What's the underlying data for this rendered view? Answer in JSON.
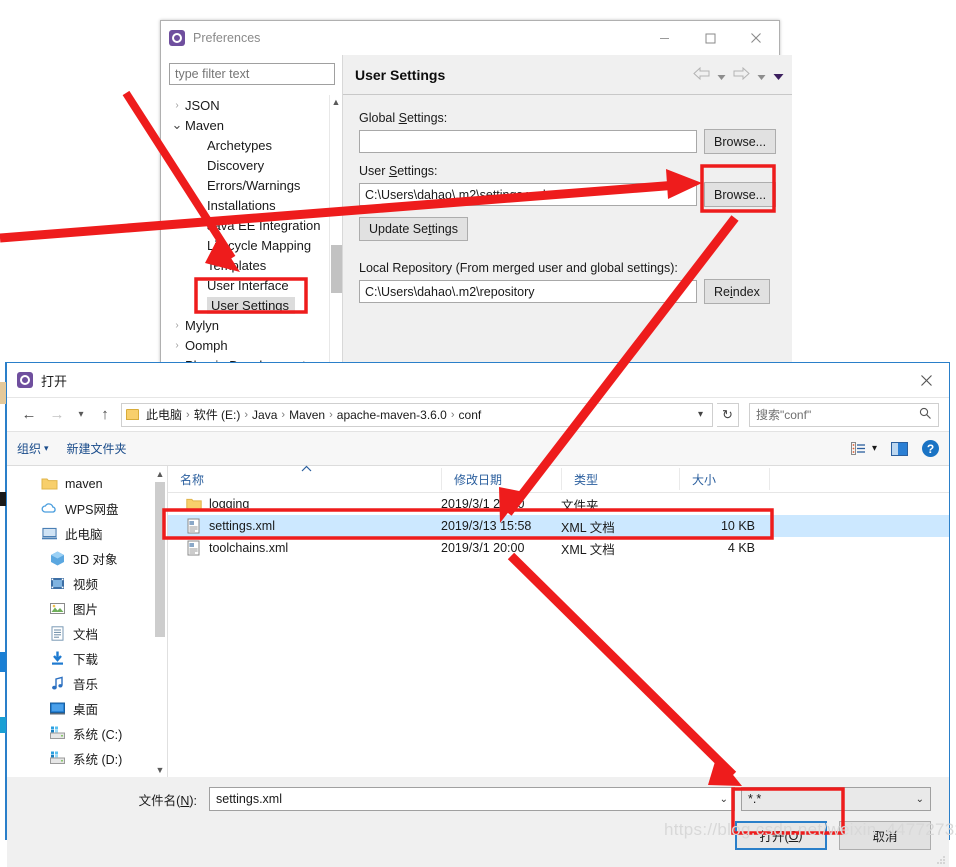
{
  "preferences": {
    "window_title": "Preferences",
    "window_icon": "eclipse-preferences-icon",
    "minimize_label": "Minimize",
    "maximize_label": "Maximize",
    "close_label": "Close",
    "filter_placeholder": "type filter text",
    "tree": [
      {
        "label": "JSON",
        "level": 1,
        "arrow": "collapsed",
        "selected": false
      },
      {
        "label": "Maven",
        "level": 1,
        "arrow": "expanded",
        "selected": false
      },
      {
        "label": "Archetypes",
        "level": 2,
        "arrow": "none",
        "selected": false
      },
      {
        "label": "Discovery",
        "level": 2,
        "arrow": "none",
        "selected": false
      },
      {
        "label": "Errors/Warnings",
        "level": 2,
        "arrow": "none",
        "selected": false
      },
      {
        "label": "Installations",
        "level": 2,
        "arrow": "none",
        "selected": false
      },
      {
        "label": "Java EE Integration",
        "level": 2,
        "arrow": "none",
        "selected": false
      },
      {
        "label": "Lifecycle Mapping",
        "level": 2,
        "arrow": "none",
        "selected": false
      },
      {
        "label": "Templates",
        "level": 2,
        "arrow": "none",
        "selected": false
      },
      {
        "label": "User Interface",
        "level": 2,
        "arrow": "none",
        "selected": false
      },
      {
        "label": "User Settings",
        "level": 2,
        "arrow": "none",
        "selected": true
      },
      {
        "label": "Mylyn",
        "level": 1,
        "arrow": "collapsed",
        "selected": false
      },
      {
        "label": "Oomph",
        "level": 1,
        "arrow": "collapsed",
        "selected": false
      },
      {
        "label": "Plug-in Development",
        "level": 1,
        "arrow": "collapsed",
        "selected": false
      }
    ],
    "page_title": "User Settings",
    "nav": {
      "back_label": "Back",
      "forward_label": "Forward",
      "menu_label": "View Menu"
    },
    "global_settings": {
      "label_pre": "Global ",
      "label_accel": "S",
      "label_post": "ettings:",
      "value": "",
      "browse_label": "Browse..."
    },
    "user_settings": {
      "label_pre": "User ",
      "label_accel": "S",
      "label_post": "ettings:",
      "value": "C:\\Users\\dahao\\.m2\\settings.xml",
      "browse_label": "Browse...",
      "update_pre": "Update Se",
      "update_accel": "t",
      "update_post": "tings"
    },
    "local_repository": {
      "label": "Local Repository (From merged user and global settings):",
      "value": "C:\\Users\\dahao\\.m2\\repository",
      "reindex_pre": "Re",
      "reindex_accel": "i",
      "reindex_post": "ndex"
    }
  },
  "open_dialog": {
    "title": "打开",
    "title_icon": "eclipse-open-icon",
    "close_label": "关闭",
    "address": {
      "back_label": "后退",
      "forward_label": "前进",
      "recent_label": "最近浏览的位置",
      "up_label": "上移一级",
      "folder_icon": "folder-icon",
      "crumbs": [
        "此电脑",
        "软件 (E:)",
        "Java",
        "Maven",
        "apache-maven-3.6.0",
        "conf"
      ],
      "separator": "›",
      "dropdown_caret": "▾",
      "refresh_label": "刷新",
      "search_placeholder": "搜索\"conf\"",
      "search_icon": "search-icon"
    },
    "toolbar": {
      "organize_label": "组织",
      "organize_caret": "▾",
      "new_folder_label": "新建文件夹",
      "view_icon": "view-list-icon",
      "view_caret": "▾",
      "pane_icon": "preview-pane-icon",
      "help_icon": "help-icon",
      "help_glyph": "?"
    },
    "nav_pane": [
      {
        "label": "maven",
        "icon": "folder-icon",
        "indent": false
      },
      {
        "label": "WPS网盘",
        "icon": "cloud-icon",
        "indent": false
      },
      {
        "label": "此电脑",
        "icon": "computer-icon",
        "indent": false
      },
      {
        "label": "3D 对象",
        "icon": "3d-object-icon",
        "indent": true
      },
      {
        "label": "视频",
        "icon": "video-icon",
        "indent": true
      },
      {
        "label": "图片",
        "icon": "picture-icon",
        "indent": true
      },
      {
        "label": "文档",
        "icon": "document-icon",
        "indent": true
      },
      {
        "label": "下载",
        "icon": "download-icon",
        "indent": true
      },
      {
        "label": "音乐",
        "icon": "music-icon",
        "indent": true
      },
      {
        "label": "桌面",
        "icon": "desktop-icon",
        "indent": true
      },
      {
        "label": "系统 (C:)",
        "icon": "drive-icon",
        "indent": true
      },
      {
        "label": "系统 (D:)",
        "icon": "drive-icon",
        "indent": true
      }
    ],
    "columns": {
      "name": "名称",
      "date": "修改日期",
      "type": "类型",
      "size": "大小",
      "sort_caret": "▲"
    },
    "files": [
      {
        "name": "logging",
        "icon": "folder-icon",
        "date": "2019/3/1 20:20",
        "type": "文件夹",
        "size": "",
        "selected": false
      },
      {
        "name": "settings.xml",
        "icon": "xml-file-icon",
        "date": "2019/3/13 15:58",
        "type": "XML 文档",
        "size": "10 KB",
        "selected": true
      },
      {
        "name": "toolchains.xml",
        "icon": "xml-file-icon",
        "date": "2019/3/1 20:00",
        "type": "XML 文档",
        "size": "4 KB",
        "selected": false
      }
    ],
    "footer": {
      "filename_label_pre": "文件名(",
      "filename_label_accel": "N",
      "filename_label_post": "):",
      "filename_value": "settings.xml",
      "filename_caret": "⌄",
      "filter_value": "*.*",
      "filter_caret": "⌄",
      "open_pre": "打开(",
      "open_accel": "O",
      "open_post": ")",
      "cancel_label": "取消"
    }
  },
  "annotations": {
    "accent_color": "#ee1c1c",
    "highlight_boxes": [
      {
        "name": "user-settings-tree-highlight"
      },
      {
        "name": "browse-button-highlight"
      },
      {
        "name": "settings-xml-row-highlight"
      },
      {
        "name": "open-button-highlight"
      }
    ],
    "arrows": [
      {
        "name": "arrow-to-templates"
      },
      {
        "name": "arrow-to-browse-button"
      },
      {
        "name": "arrow-to-settings-xml"
      },
      {
        "name": "arrow-to-open-button"
      }
    ]
  },
  "watermark": {
    "text": "https://blog.csdn.net/weixin_44772732"
  }
}
